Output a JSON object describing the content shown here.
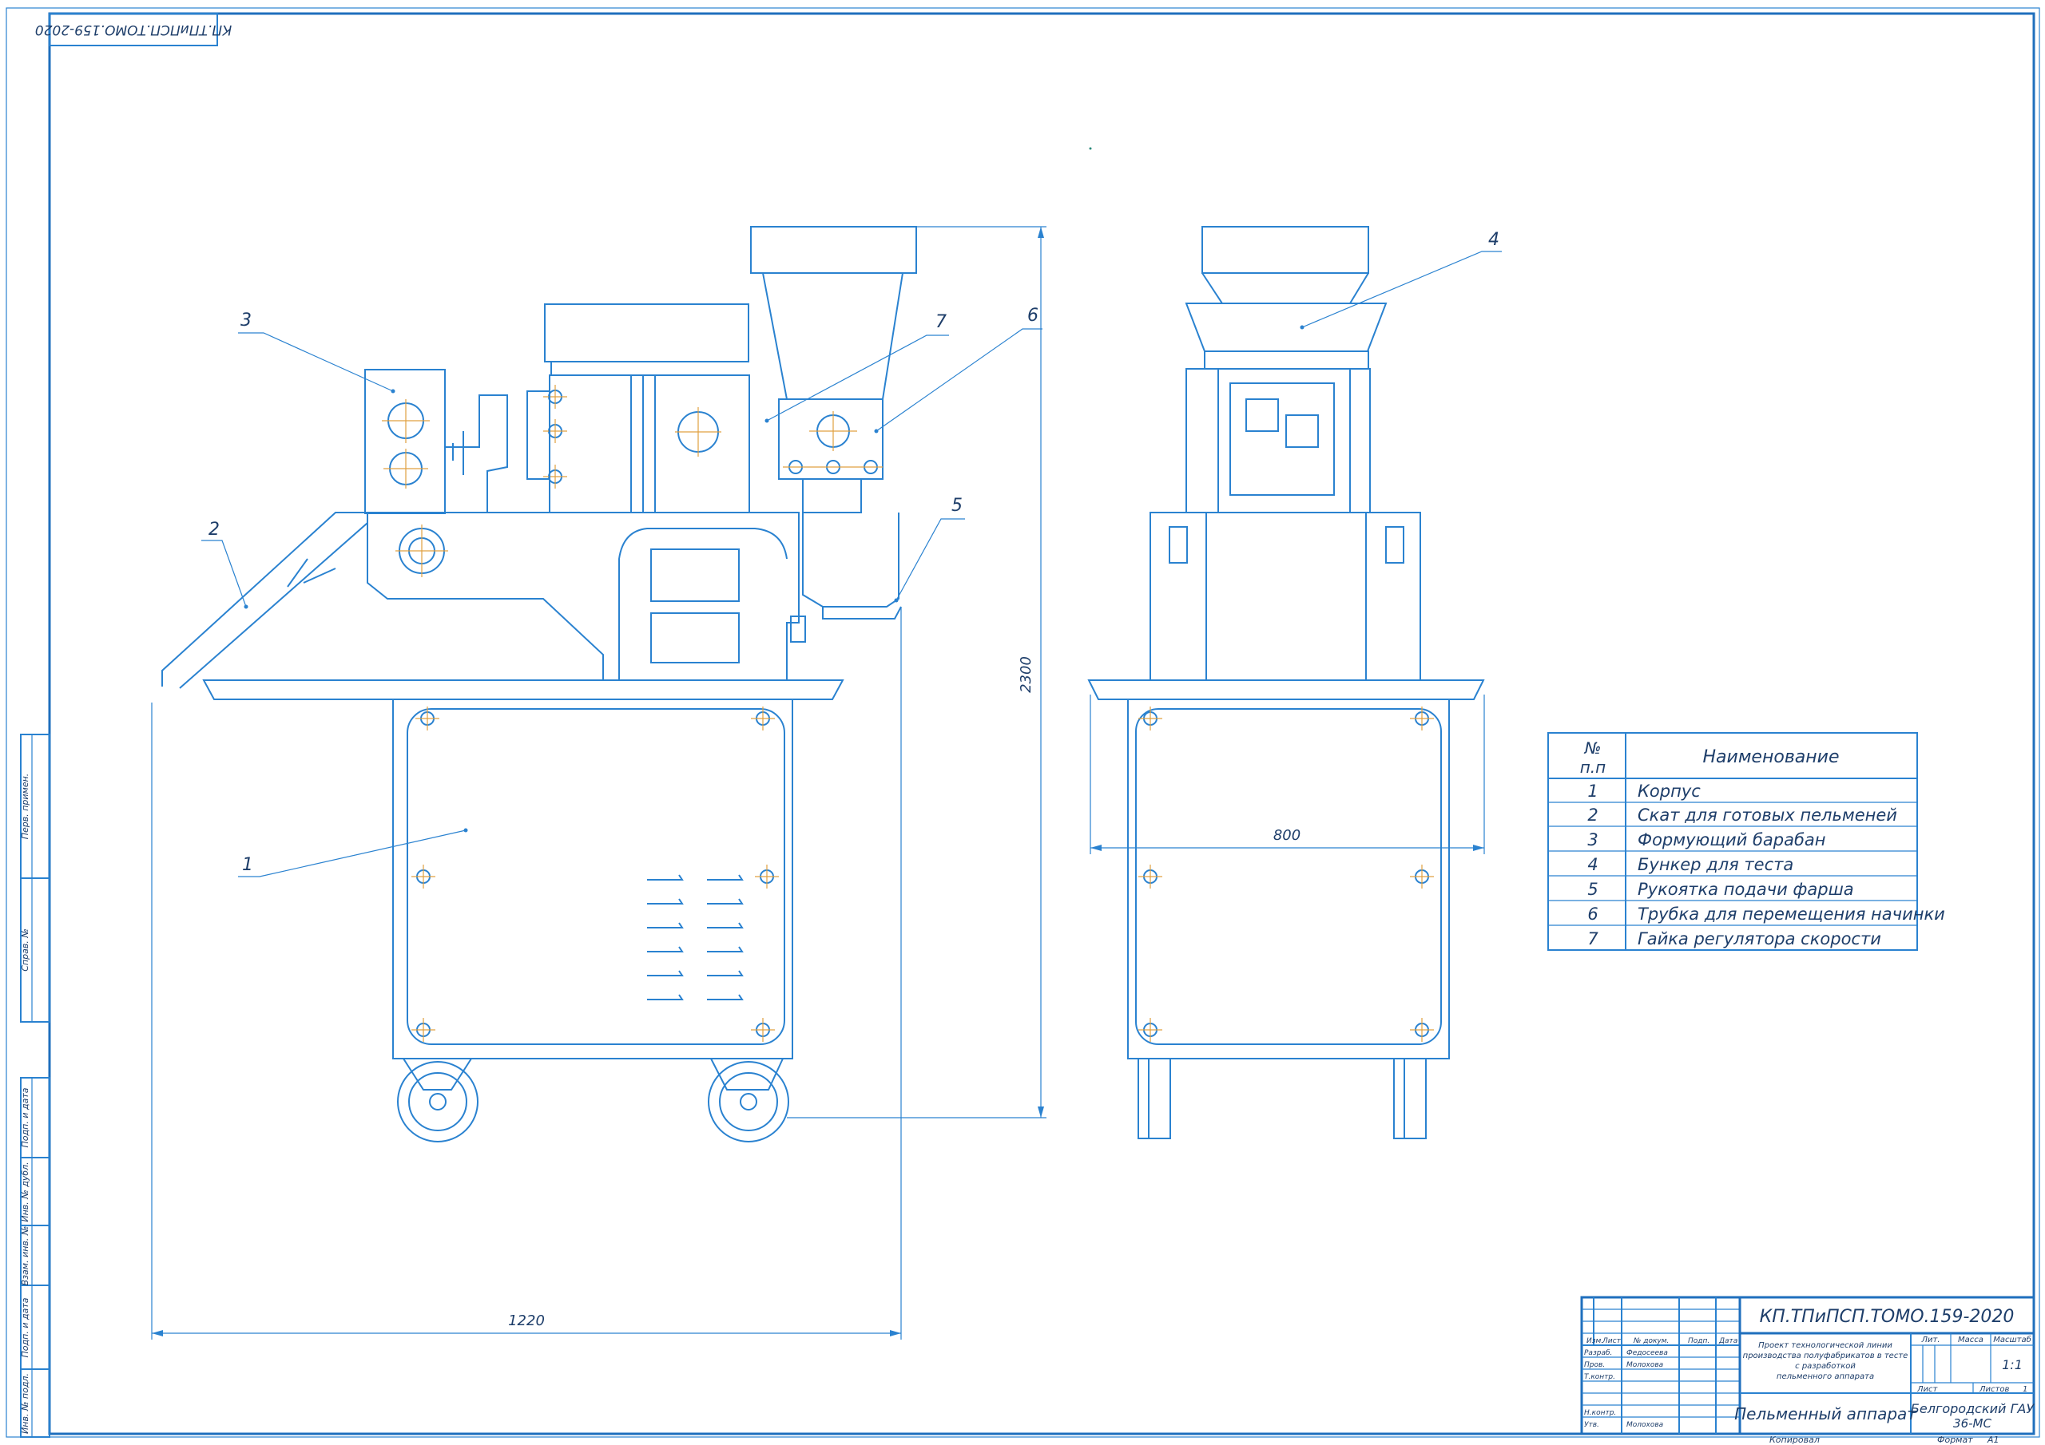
{
  "drawing": {
    "code_stamp": "КП.ТПиПСП.ТОМО.159-2020",
    "callouts": [
      "1",
      "2",
      "3",
      "4",
      "5",
      "6",
      "7"
    ],
    "dimensions": {
      "height": "2300",
      "length": "1220",
      "width": "800"
    }
  },
  "parts_table": {
    "header_num": "№\nп.п",
    "header_num_line1": "№",
    "header_num_line2": "п.п",
    "header_name": "Наименование",
    "rows": [
      {
        "num": "1",
        "name": "Корпус"
      },
      {
        "num": "2",
        "name": "Скат для готовых пельменей"
      },
      {
        "num": "3",
        "name": "Формующий барабан"
      },
      {
        "num": "4",
        "name": "Бункер для теста"
      },
      {
        "num": "5",
        "name": "Рукоятка подачи фарша"
      },
      {
        "num": "6",
        "name": "Трубка для перемещения начинки"
      },
      {
        "num": "7",
        "name": "Гайка регулятора скорости"
      }
    ]
  },
  "side_stamps": [
    "Перв. примен.",
    "Справ. №",
    "Подп. и дата",
    "Инв. № дубл.",
    "Взам. инв. №",
    "Подп. и дата",
    "Инв. № подл."
  ],
  "title_block": {
    "designation": "КП.ТПиПСП.ТОМО.159-2020",
    "project_title_lines": [
      "Проект технологической линии",
      "производства полуфабрикатов в тесте",
      "с разработкой",
      "пельменного аппарата"
    ],
    "item_title": "Пельменный аппарат",
    "organization": "Белгородский ГАУ",
    "group": "36-МС",
    "col_izm": "Изм.",
    "col_list": "Лист",
    "col_doc": "№ докум.",
    "col_sign": "Подп.",
    "col_date": "Дата",
    "role_developer": "Разраб.",
    "name_developer": "Федосеева",
    "role_checked": "Пров.",
    "name_checked": "Молохова",
    "role_tcontrol": "Т.контр.",
    "role_ncontrol": "Н.контр.",
    "role_approved": "Утв.",
    "name_approved": "Молохова",
    "lit_label": "Лит.",
    "mass_label": "Масса",
    "scale_label": "Масштаб",
    "scale_value": "1:1",
    "sheet_label": "Лист",
    "sheets_label": "Листов",
    "sheets_value": "1",
    "copied_label": "Копировал",
    "format_label": "Формат",
    "format_value": "А1"
  }
}
